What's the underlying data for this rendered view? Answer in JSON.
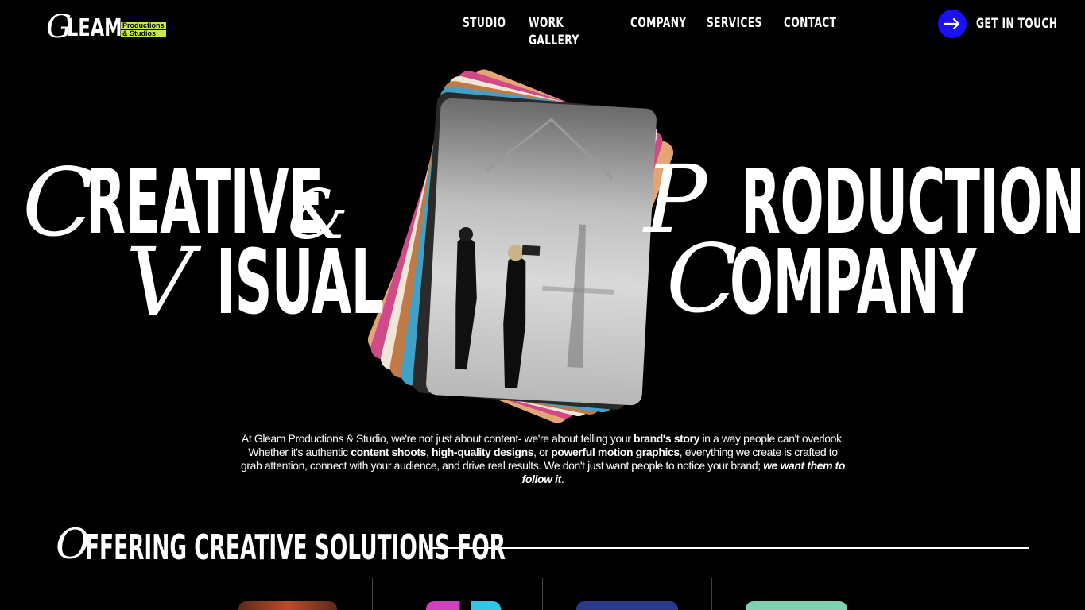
{
  "brand": {
    "logo_initial": "G",
    "logo_word": "LEAM",
    "tag_line1": "Productions",
    "tag_line2": "& Studios",
    "accent": "#c8e84a"
  },
  "nav": {
    "items": [
      {
        "label": "STUDIO"
      },
      {
        "label": "WORK GALLERY"
      },
      {
        "label": "COMPANY"
      },
      {
        "label": "SERVICES"
      },
      {
        "label": "CONTACT"
      }
    ]
  },
  "cta": {
    "label": "GET IN TOUCH",
    "icon": "arrow-right-icon",
    "color": "#1a10ff"
  },
  "hero": {
    "line1_cap": "C",
    "line1_rest": "REATIVE",
    "amp": "&",
    "line2_cap": "V",
    "line2_rest": "ISUAL",
    "line3_cap": "P",
    "line3_rest": "RODUCTION",
    "line4_cap": "C",
    "line4_rest": "OMPANY"
  },
  "description": {
    "p1": "At Gleam Productions & Studio, we're not just about content- we're about telling your ",
    "b1": "brand's story",
    "p2": " in a way people can't overlook. Whether it's authentic ",
    "b2": "content shoots",
    "p3": ", ",
    "b3": "high-quality designs",
    "p4": ", or ",
    "b4": "powerful motion graphics",
    "p5": ", everything we create is crafted to grab attention, connect with your audience, and drive real results. We don't just want people to notice your brand; ",
    "b5": "we want them to follow it",
    "p6": "."
  },
  "offering": {
    "cap": "O",
    "rest": "FFERING CREATIVE SOLUTIONS FOR"
  }
}
